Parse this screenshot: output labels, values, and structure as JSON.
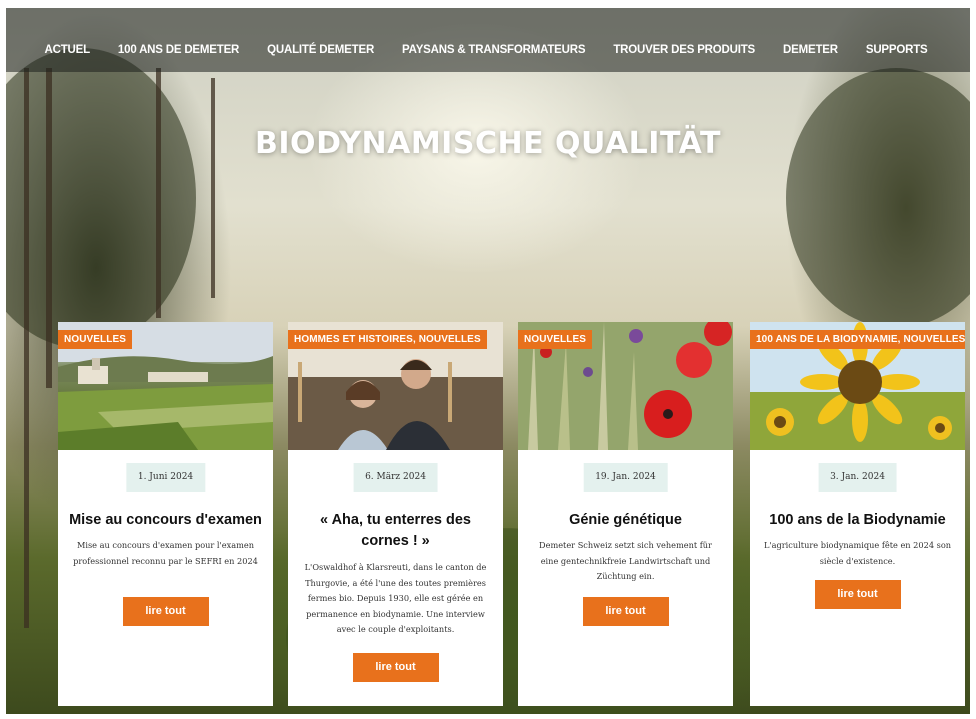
{
  "nav": {
    "items": [
      "ACTUEL",
      "100 ANS DE DEMETER",
      "QUALITÉ DEMETER",
      "PAYSANS & TRANSFORMATEURS",
      "TROUVER DES PRODUITS",
      "DEMETER",
      "SUPPORTS"
    ]
  },
  "hero": {
    "title": "BIODYNAMISCHE QUALITÄT"
  },
  "colors": {
    "accent": "#e8711c",
    "date_bg": "#e4f1ee"
  },
  "cards": [
    {
      "tag": "NOUVELLES",
      "date": "1. Juni 2024",
      "title": "Mise au concours d'examen",
      "text": "Mise au concours d'examen pour l'examen professionnel reconnu par le SEFRI en 2024",
      "button": "lire tout"
    },
    {
      "tag": "HOMMES ET HISTOIRES, NOUVELLES",
      "date": "6. März 2024",
      "title": "« Aha, tu enterres des cornes ! »",
      "text": "L'Oswaldhof à Klarsreuti, dans le canton de Thurgovie, a été l'une des toutes premières fermes bio. Depuis 1930, elle est gérée en permanence en biodynamie. Une interview avec le couple d'exploitants.",
      "button": "lire tout"
    },
    {
      "tag": "NOUVELLES",
      "date": "19. Jan. 2024",
      "title": "Génie génétique",
      "text": "Demeter Schweiz setzt sich vehement für eine gentechnikfreie Landwirtschaft und Züchtung ein.",
      "button": "lire tout"
    },
    {
      "tag": "100 ANS DE LA BIODYNAMIE, NOUVELLES",
      "date": "3. Jan. 2024",
      "title": "100 ans de la Biodynamie",
      "text": "L'agriculture biodynamique fête en 2024 son siècle d'existence.",
      "button": "lire tout"
    }
  ]
}
